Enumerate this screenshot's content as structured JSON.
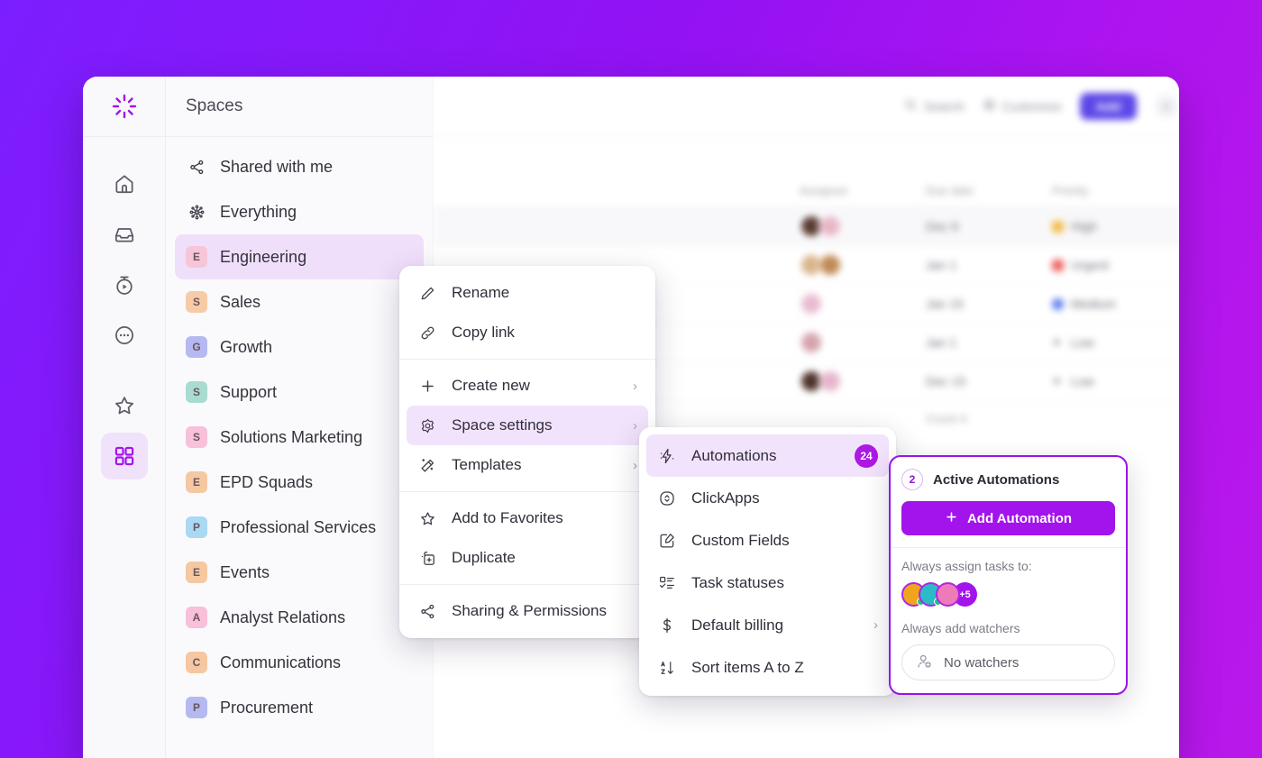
{
  "app": {
    "logo_icon": "clickup-burst-logo-icon"
  },
  "sidebar_rail": {
    "items": [
      {
        "icon": "home-icon",
        "name": "home"
      },
      {
        "icon": "inbox-icon",
        "name": "inbox"
      },
      {
        "icon": "timer-play-icon",
        "name": "timer"
      },
      {
        "icon": "more-circle-icon",
        "name": "more"
      },
      {
        "icon": "star-icon",
        "name": "favorites"
      },
      {
        "icon": "grid-apps-icon",
        "name": "spaces",
        "active": true
      }
    ]
  },
  "spaces_panel": {
    "title": "Spaces",
    "items": [
      {
        "label": "Shared with me",
        "icon": "share-nodes-icon",
        "type": "icon"
      },
      {
        "label": "Everything",
        "icon": "everything-icon",
        "type": "icon"
      },
      {
        "label": "Engineering",
        "badge": "E",
        "color": "#F7C5D8",
        "selected": true
      },
      {
        "label": "Sales",
        "badge": "S",
        "color": "#F6CCA6"
      },
      {
        "label": "Growth",
        "badge": "G",
        "color": "#B5B9F2"
      },
      {
        "label": "Support",
        "badge": "S",
        "color": "#A9DCD1"
      },
      {
        "label": "Solutions Marketing",
        "badge": "S",
        "color": "#F8C0DA"
      },
      {
        "label": "EPD Squads",
        "badge": "E",
        "color": "#F5C8A2"
      },
      {
        "label": "Professional Services",
        "badge": "P",
        "color": "#A9D9F3"
      },
      {
        "label": "Events",
        "badge": "E",
        "color": "#F5C8A2"
      },
      {
        "label": "Analyst Relations",
        "badge": "A",
        "color": "#F8C0DA"
      },
      {
        "label": "Communications",
        "badge": "C",
        "color": "#F5C8A2"
      },
      {
        "label": "Procurement",
        "badge": "P",
        "color": "#B5B9F2"
      }
    ]
  },
  "topbar": {
    "search_label": "Search",
    "customize_label": "Customize",
    "add_label": "Add",
    "chevron_icon": "chevron-down-icon",
    "search_icon": "search-icon",
    "customize_icon": "gear-icon"
  },
  "task_table": {
    "columns": [
      "",
      "Assignee",
      "Due date",
      "Priority",
      ""
    ],
    "rows": [
      {
        "assignees": [
          "#5A3B32",
          "#E8B7C6"
        ],
        "due": "Dec 6",
        "priority": "High",
        "priority_color": "#F5B945",
        "highlight": true
      },
      {
        "assignees": [
          "#D9B48A",
          "#C08A56"
        ],
        "due": "Jan 1",
        "priority": "Urgent",
        "priority_color": "#EE5E5E"
      },
      {
        "assignees": [
          "#E9BBD2"
        ],
        "due": "Jan 15",
        "priority": "Medium",
        "priority_color": "#5A7BF0"
      },
      {
        "assignees": [
          "#D5A3AE"
        ],
        "due": "Jan 1",
        "priority": "Low",
        "priority_color": "#A8A8B4"
      },
      {
        "assignees": [
          "#4E3229",
          "#E6B6CB"
        ],
        "due": "Dec 15",
        "priority": "Low",
        "priority_color": "#A8A8B4"
      }
    ],
    "count_label": "Count  4"
  },
  "context_menu": {
    "groups": [
      [
        {
          "label": "Rename",
          "icon": "pencil-icon",
          "arrow": false
        },
        {
          "label": "Copy link",
          "icon": "link-icon",
          "arrow": false
        }
      ],
      [
        {
          "label": "Create new",
          "icon": "plus-icon",
          "arrow": true
        },
        {
          "label": "Space settings",
          "icon": "gear-icon",
          "arrow": true,
          "highlight": true
        },
        {
          "label": "Templates",
          "icon": "magic-wand-icon",
          "arrow": true
        }
      ],
      [
        {
          "label": "Add to Favorites",
          "icon": "star-icon",
          "arrow": false
        },
        {
          "label": "Duplicate",
          "icon": "duplicate-icon",
          "arrow": false
        }
      ],
      [
        {
          "label": "Sharing & Permissions",
          "icon": "share-nodes-icon",
          "arrow": false
        }
      ]
    ]
  },
  "submenu": {
    "items": [
      {
        "label": "Automations",
        "icon": "lightning-bolt-icon",
        "badge": "24",
        "highlight": true
      },
      {
        "label": "ClickApps",
        "icon": "clickapps-icon"
      },
      {
        "label": "Custom Fields",
        "icon": "edit-square-icon"
      },
      {
        "label": "Task statuses",
        "icon": "checklist-icon"
      },
      {
        "label": "Default billing",
        "icon": "dollar-icon",
        "arrow": true
      },
      {
        "label": "Sort items A to Z",
        "icon": "sort-az-icon"
      }
    ]
  },
  "automations_popover": {
    "count": "2",
    "title": "Active Automations",
    "add_button_label": "Add Automation",
    "add_button_icon": "plus-icon",
    "assign_label": "Always assign tasks to:",
    "assignees": [
      {
        "color": "#F0A61C",
        "name": "avatar-1"
      },
      {
        "color": "#2BBBC6",
        "name": "avatar-2"
      },
      {
        "color": "#EF7AB9",
        "name": "avatar-3"
      }
    ],
    "assignees_overflow": "+5",
    "watchers_label": "Always add watchers",
    "watchers_value": "No watchers",
    "watchers_icon": "add-person-icon"
  },
  "colors": {
    "brand_purple": "#A313EC",
    "accent_purple": "#9A13E8",
    "background_gradient_start": "#7B1EFF",
    "background_gradient_end": "#BA18EA",
    "badge_purple": "#AB19E3",
    "add_button_blue": "#5C48E8"
  }
}
